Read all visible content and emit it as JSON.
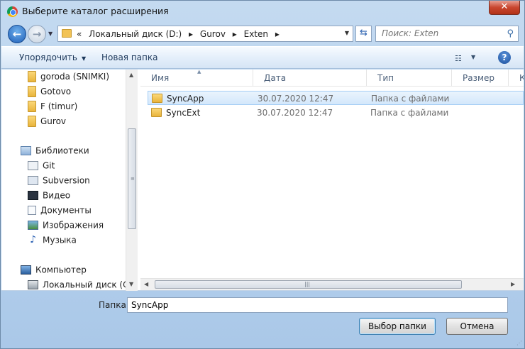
{
  "window": {
    "title": "Выберите каталог расширения",
    "close_label": "✕"
  },
  "nav": {
    "back_glyph": "←",
    "forward_glyph": "→",
    "breadcrumb": [
      "«",
      "Локальный диск (D:)",
      "▸",
      "Gurov",
      "▸",
      "Exten",
      "▸"
    ],
    "search_placeholder": "Поиск: Exten"
  },
  "toolbar": {
    "organize_label": "Упорядочить",
    "new_folder_label": "Новая папка",
    "help_label": "?"
  },
  "tree": {
    "items": [
      {
        "label": "goroda (SNIMKI)",
        "icon": "folder-icon"
      },
      {
        "label": "Gotovo",
        "icon": "folder-icon"
      },
      {
        "label": "F (timur)",
        "icon": "folder-icon"
      },
      {
        "label": "Gurov",
        "icon": "folder-icon"
      },
      {
        "label": "Библиотеки",
        "icon": "libraries-icon"
      },
      {
        "label": "Git",
        "icon": "git-icon"
      },
      {
        "label": "Subversion",
        "icon": "subversion-icon"
      },
      {
        "label": "Видео",
        "icon": "video-icon"
      },
      {
        "label": "Документы",
        "icon": "documents-icon"
      },
      {
        "label": "Изображения",
        "icon": "images-icon"
      },
      {
        "label": "Музыка",
        "icon": "music-icon"
      },
      {
        "label": "Компьютер",
        "icon": "computer-icon"
      },
      {
        "label": "Локальный диск (C:)",
        "icon": "disk-icon"
      }
    ]
  },
  "filelist": {
    "columns": [
      "Имя",
      "Дата",
      "Тип",
      "Размер",
      "Кл"
    ],
    "rows": [
      {
        "name": "SyncApp",
        "date": "30.07.2020 12:47",
        "type": "Папка с файлами",
        "selected": true
      },
      {
        "name": "SyncExt",
        "date": "30.07.2020 12:47",
        "type": "Папка с файлами",
        "selected": false
      }
    ]
  },
  "footer": {
    "folder_label": "Папка:",
    "folder_value": "SyncApp",
    "ok_label": "Выбор папки",
    "cancel_label": "Отмена"
  },
  "colors": {
    "title_bg": "#b9d3ee",
    "close_red": "#c9462f",
    "selection": "#d3e7fb",
    "folder_yellow": "#f2c356"
  }
}
